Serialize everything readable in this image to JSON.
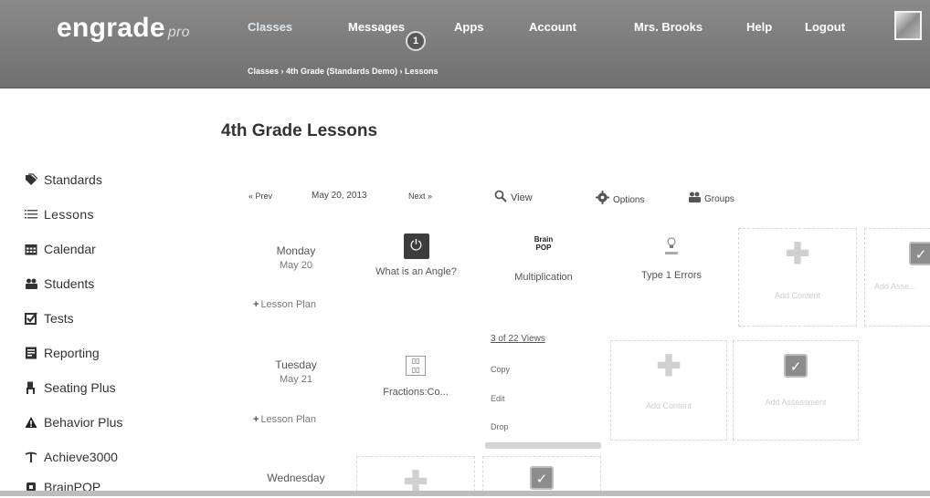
{
  "header": {
    "brand": "engrade",
    "brand_suffix": "pro",
    "nav": [
      "Classes",
      "Messages",
      "Apps",
      "Account",
      "Mrs. Brooks",
      "Help",
      "Logout"
    ],
    "messages_badge": "1",
    "breadcrumb": "Classes › 4th Grade (Standards Demo) › Lessons"
  },
  "page_title": "4th Grade Lessons",
  "sidebar": [
    {
      "label": "Standards",
      "icon": "tag-icon"
    },
    {
      "label": "Lessons",
      "icon": "list-icon"
    },
    {
      "label": "Calendar",
      "icon": "calendar-icon"
    },
    {
      "label": "Students",
      "icon": "users-icon"
    },
    {
      "label": "Tests",
      "icon": "checkbox-icon"
    },
    {
      "label": "Reporting",
      "icon": "report-icon"
    },
    {
      "label": "Seating Plus",
      "icon": "chair-icon"
    },
    {
      "label": "Behavior Plus",
      "icon": "warning-icon"
    },
    {
      "label": "Achieve3000",
      "icon": "achieve-icon"
    },
    {
      "label": "BrainPOP",
      "icon": "brainpop-icon"
    }
  ],
  "toolbar": {
    "prev": "« Prev",
    "date": "May 20, 2013",
    "next": "Next »",
    "view": "View",
    "options": "Options",
    "groups": "Groups"
  },
  "days": [
    {
      "name": "Monday",
      "date": "May 20",
      "plan": "Lesson Plan"
    },
    {
      "name": "Tuesday",
      "date": "May 21",
      "plan": "Lesson Plan"
    },
    {
      "name": "Wednesday",
      "date": ""
    }
  ],
  "lessons": {
    "angle": "What is an Angle?",
    "multiplication": "Multiplication",
    "type1": "Type 1 Errors",
    "fractions": "Fractions:Co..."
  },
  "tiles": {
    "add_content": "Add Content",
    "add_assessment": "Add Assessment",
    "add_assessment_cut": "Add Asse..."
  },
  "menu": {
    "views": "3 of 22 Views",
    "copy": "Copy",
    "edit": "Edit",
    "drop": "Drop"
  }
}
